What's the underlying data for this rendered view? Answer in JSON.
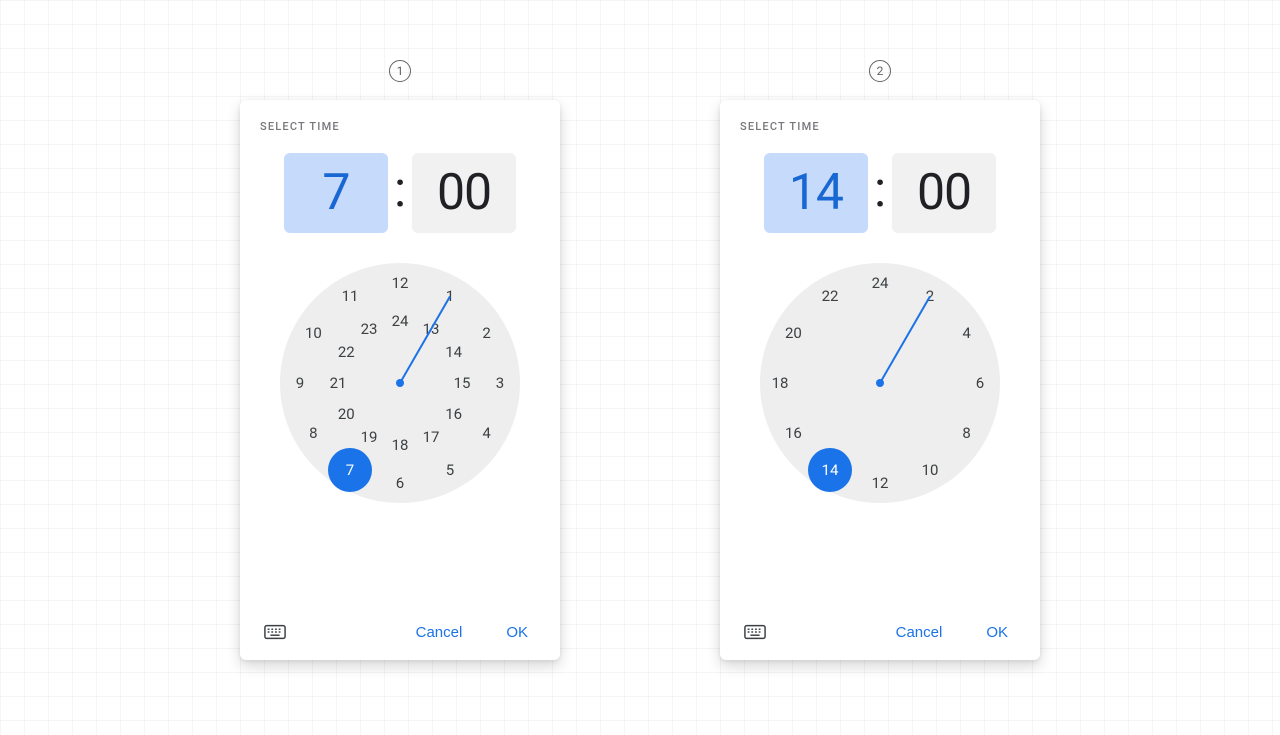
{
  "colors": {
    "primary": "#1a73e8",
    "primary_container": "#c6dafc",
    "primary_text": "#1967d2",
    "surface_variant": "#f1f1f1",
    "clock_face": "#eeeeee",
    "text": "#202124",
    "text_secondary": "#77787c"
  },
  "dialogs": [
    {
      "badge": "1",
      "title": "SELECT TIME",
      "hour": "7",
      "minute": "00",
      "active_field": "hour",
      "clock": {
        "outer": [
          "12",
          "1",
          "2",
          "3",
          "4",
          "5",
          "6",
          "7",
          "8",
          "9",
          "10",
          "11"
        ],
        "inner": [
          "24",
          "13",
          "14",
          "15",
          "16",
          "17",
          "18",
          "19",
          "20",
          "21",
          "22",
          "23"
        ],
        "selected_label": "7",
        "selected_angle": 210,
        "selected_ring": "outer"
      },
      "cancel_label": "Cancel",
      "ok_label": "OK"
    },
    {
      "badge": "2",
      "title": "SELECT TIME",
      "hour": "14",
      "minute": "00",
      "active_field": "hour",
      "clock": {
        "outer": [
          "24",
          "2",
          "4",
          "6",
          "8",
          "10",
          "12",
          "14",
          "16",
          "18",
          "20",
          "22"
        ],
        "inner": null,
        "selected_label": "14",
        "selected_angle": 210,
        "selected_ring": "outer"
      },
      "cancel_label": "Cancel",
      "ok_label": "OK"
    }
  ]
}
